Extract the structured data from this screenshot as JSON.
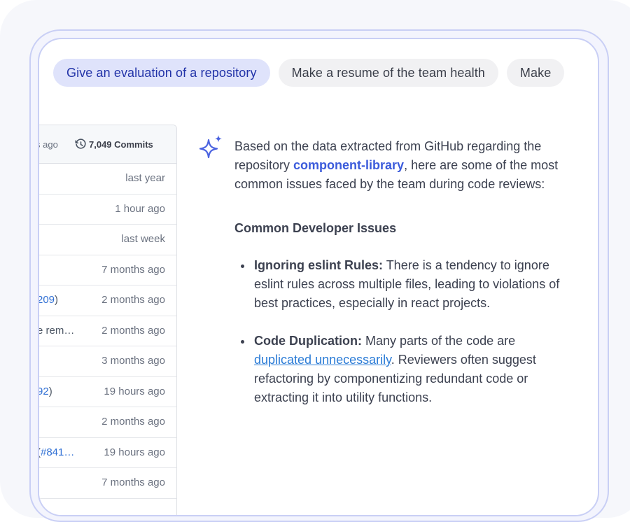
{
  "chips": [
    {
      "label": "Give an evaluation of a repository",
      "active": true
    },
    {
      "label": "Make a resume of the team health",
      "active": false
    },
    {
      "label": "Make",
      "active": false
    }
  ],
  "repo_panel": {
    "header_ago": "s ago",
    "commits_label": "7,049 Commits",
    "rows": [
      {
        "msg_pre": "",
        "msg_link": "",
        "msg_post": "",
        "time": "last year"
      },
      {
        "msg_pre": "",
        "msg_link": "",
        "msg_post": "",
        "time": "1 hour ago"
      },
      {
        "msg_pre": "",
        "msg_link": "",
        "msg_post": "",
        "time": "last week"
      },
      {
        "msg_pre": "",
        "msg_link": "",
        "msg_post": "",
        "time": "7 months ago"
      },
      {
        "msg_pre": "",
        "msg_link": "209",
        "msg_post": ")",
        "time": "2 months ago"
      },
      {
        "msg_pre": "e rem…",
        "msg_link": "",
        "msg_post": "",
        "time": "2 months ago"
      },
      {
        "msg_pre": "",
        "msg_link": "",
        "msg_post": "",
        "time": "3 months ago"
      },
      {
        "msg_pre": "",
        "msg_link": "92",
        "msg_post": ")",
        "time": "19 hours ago"
      },
      {
        "msg_pre": "",
        "msg_link": "",
        "msg_post": "",
        "time": "2 months ago"
      },
      {
        "msg_pre": "(",
        "msg_link": "#841…",
        "msg_post": "",
        "time": "19 hours ago"
      },
      {
        "msg_pre": "",
        "msg_link": "",
        "msg_post": "",
        "time": "7 months ago"
      }
    ]
  },
  "answer": {
    "intro_before": "Based on the data extracted from GitHub regarding the repository ",
    "repo_name": "component-library",
    "intro_after": ", here are some of the most common issues faced by the team during code reviews:",
    "section_title": "Common Developer Issues",
    "issue1_title": "Ignoring eslint Rules:",
    "issue1_text": " There is a tendency to ignore eslint rules across multiple files, leading to violations of best practices, especially in react projects.",
    "issue2_title": "Code Duplication:",
    "issue2_text_before": " Many parts of the code are ",
    "issue2_link": "duplicated unnecessarily",
    "issue2_text_after": ". Reviewers often suggest refactoring by componentizing redundant code or extracting it into utility functions."
  },
  "colors": {
    "accent": "#3b5bdb",
    "chip_active_bg": "#dfe3fb",
    "link": "#2a7bd6",
    "device_border": "#c9cff5"
  },
  "icons": {
    "assistant": "sparkle-icon",
    "commits": "history-icon"
  }
}
